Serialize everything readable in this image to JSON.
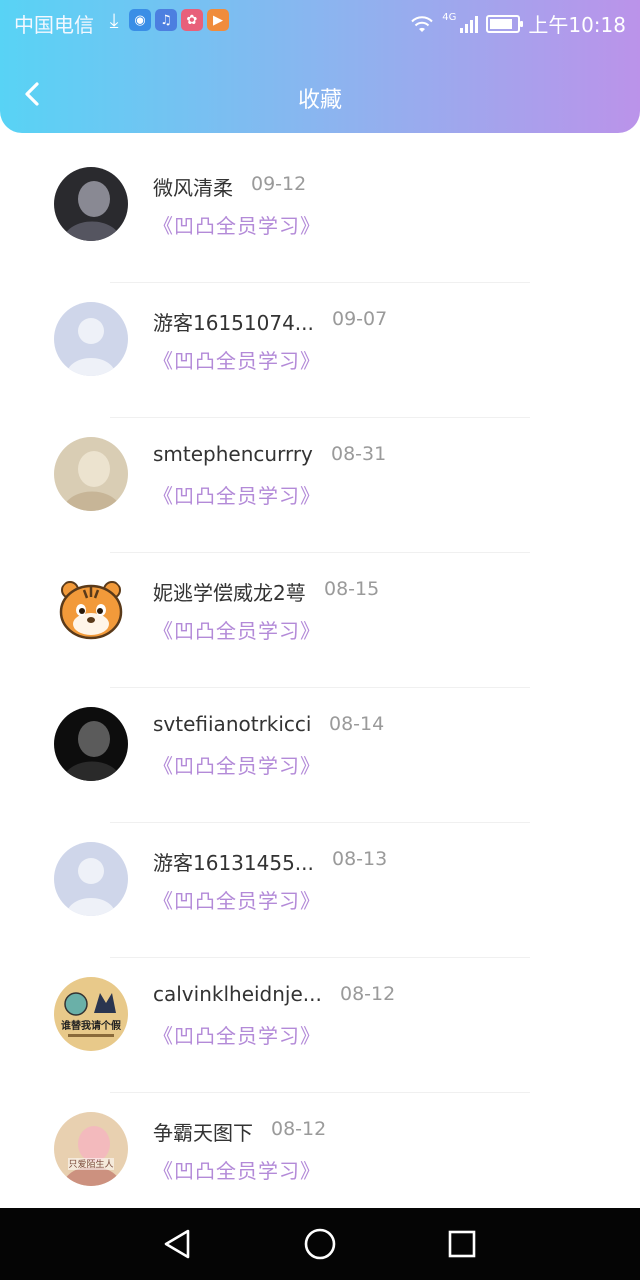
{
  "status_bar": {
    "carrier": "中国电信",
    "network": "4G",
    "time": "上午10:18",
    "battery_level": 0.85,
    "icons": [
      "download-icon",
      "app-icon",
      "music-icon",
      "app-store-icon",
      "video-icon"
    ]
  },
  "header": {
    "title": "收藏",
    "back_icon": "chevron-left-icon"
  },
  "colors": {
    "header_gradient_start": "#58d3f5",
    "header_gradient_end": "#bb93ea",
    "book_title": "#b38ad8",
    "date": "#9a9a9a",
    "name": "#333333"
  },
  "favorites": [
    {
      "name": "微风清柔",
      "date": "09-12",
      "book": "《凹凸全员学习》",
      "avatar": "photo-avatar"
    },
    {
      "name": "游客16151074...",
      "date": "09-07",
      "book": "《凹凸全员学习》",
      "avatar": "default-avatar"
    },
    {
      "name": "smtephencurrry",
      "date": "08-31",
      "book": "《凹凸全员学习》",
      "avatar": "photo-avatar"
    },
    {
      "name": "妮逃学偿威龙2萼",
      "date": "08-15",
      "book": "《凹凸全员学习》",
      "avatar": "tiger-avatar"
    },
    {
      "name": "svtefiianotrkicci",
      "date": "08-14",
      "book": "《凹凸全员学习》",
      "avatar": "photo-avatar"
    },
    {
      "name": "游客16131455...",
      "date": "08-13",
      "book": "《凹凸全员学习》",
      "avatar": "default-avatar"
    },
    {
      "name": "calvinklheidnje...",
      "date": "08-12",
      "book": "《凹凸全员学习》",
      "avatar": "sticker-avatar",
      "avatar_text": "谁替我请个假"
    },
    {
      "name": "争霸天图下",
      "date": "08-12",
      "book": "《凹凸全员学习》",
      "avatar": "photo-avatar",
      "avatar_text": "只爱陌生人"
    }
  ],
  "nav": {
    "back": "triangle-back-icon",
    "home": "circle-home-icon",
    "recents": "square-recents-icon"
  }
}
